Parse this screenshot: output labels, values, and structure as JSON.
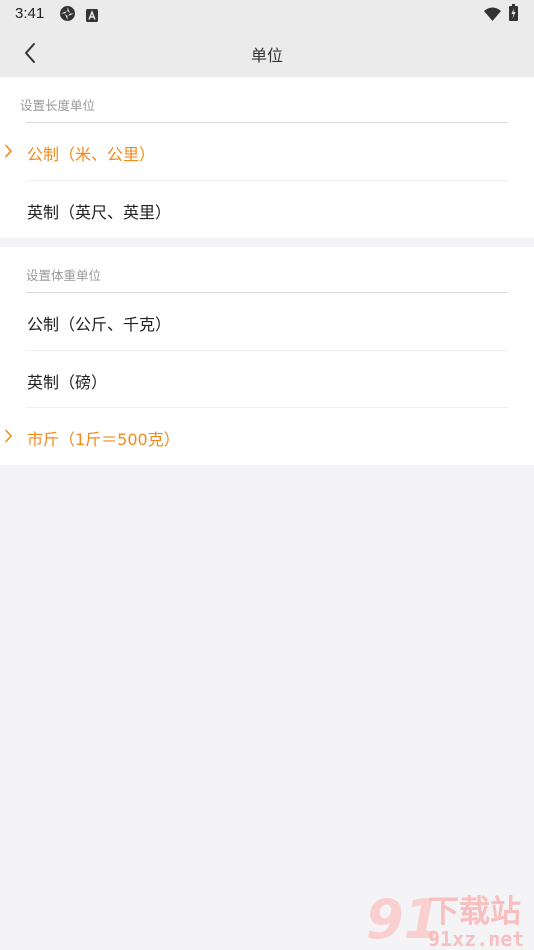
{
  "status": {
    "time": "3:41",
    "icons": [
      "aperture-icon",
      "a-badge-icon",
      "wifi-icon",
      "battery-icon"
    ]
  },
  "header": {
    "title": "单位",
    "back_icon": "chevron-left-icon"
  },
  "length_section": {
    "title": "设置长度单位",
    "items": [
      {
        "label": "公制（米、公里）",
        "selected": true
      },
      {
        "label": "英制（英尺、英里）",
        "selected": false
      }
    ]
  },
  "weight_section": {
    "title": "设置体重单位",
    "items": [
      {
        "label": "公制（公斤、千克）",
        "selected": false
      },
      {
        "label": "英制（磅）",
        "selected": false
      },
      {
        "label": "市斤（1斤＝500克）",
        "selected": true
      }
    ]
  },
  "colors": {
    "accent": "#f28a1a",
    "background": "#f4f4f6",
    "bar": "#ebebeb"
  },
  "watermark": {
    "logo_text": "91",
    "brand": "下载站",
    "url": "91xz.net"
  }
}
